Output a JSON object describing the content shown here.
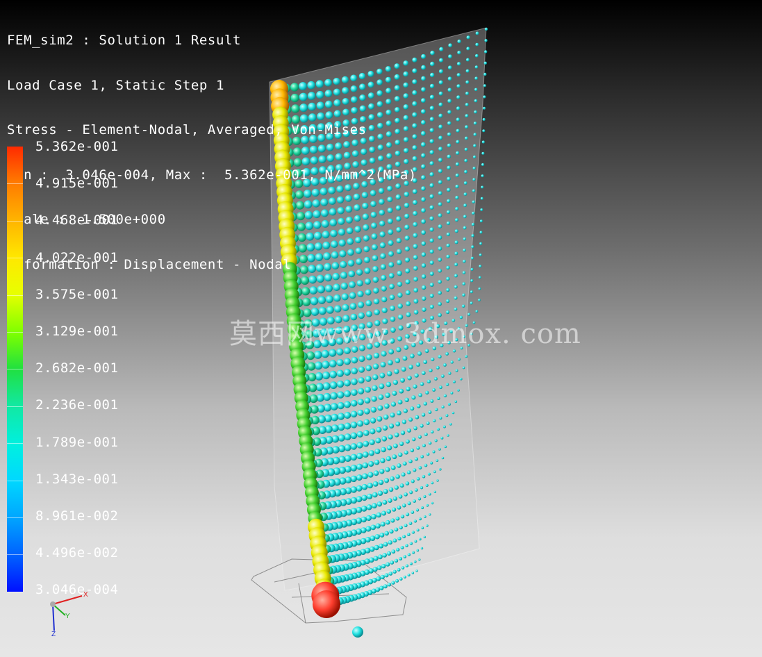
{
  "header": {
    "line1": "FEM_sim2 : Solution 1 Result",
    "line2": "Load Case 1, Static Step 1",
    "line3": "Stress - Element-Nodal, Averaged, Von-Mises",
    "line4": "Min :  3.046e-004, Max :  5.362e-001, N/mm^2(MPa)",
    "line5": "Scale :  1.500e+000",
    "line6": "Deformation : Displacement - Nodal"
  },
  "legend": {
    "labels": [
      "5.362e-001",
      "4.915e-001",
      "4.468e-001",
      "4.022e-001",
      "3.575e-001",
      "3.129e-001",
      "2.682e-001",
      "2.236e-001",
      "1.789e-001",
      "1.343e-001",
      "8.961e-002",
      "4.496e-002",
      "3.046e-004"
    ]
  },
  "watermark": "莫西网www. 3dmox. com",
  "triad": {
    "x": "X",
    "y": "Y",
    "z": "Z"
  },
  "colors": {
    "max": "#ff2a00",
    "high": "#ffe800",
    "mid": "#20e040",
    "low": "#00e8e8",
    "min": "#0010ff"
  }
}
